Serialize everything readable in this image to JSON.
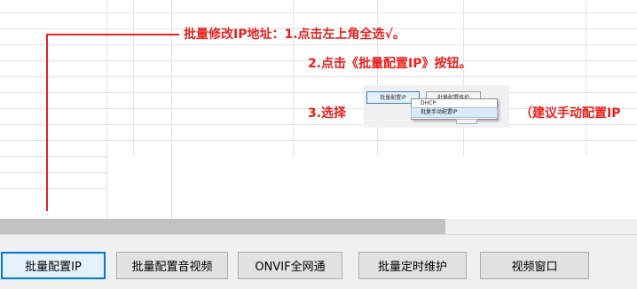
{
  "annotation": {
    "line1": "批量修改IP地址：1.点击左上角全选√。",
    "line2": "2.点击《批量配置IP》按钮。",
    "line3_prefix": "3.选择",
    "line3_suffix": "（建议手动配置IP"
  },
  "inset": {
    "button1": "批量配置IP",
    "button2": "批量配置维护",
    "menu": [
      "DHCP",
      "批量手动配置IP"
    ]
  },
  "toolbar": {
    "buttons": [
      "批量配置IP",
      "批量配置音视频",
      "ONVIF全网通",
      "批量定时维护",
      "视频窗口"
    ]
  },
  "colors": {
    "annotation": "#e8211e",
    "focus": "#0078d7"
  }
}
